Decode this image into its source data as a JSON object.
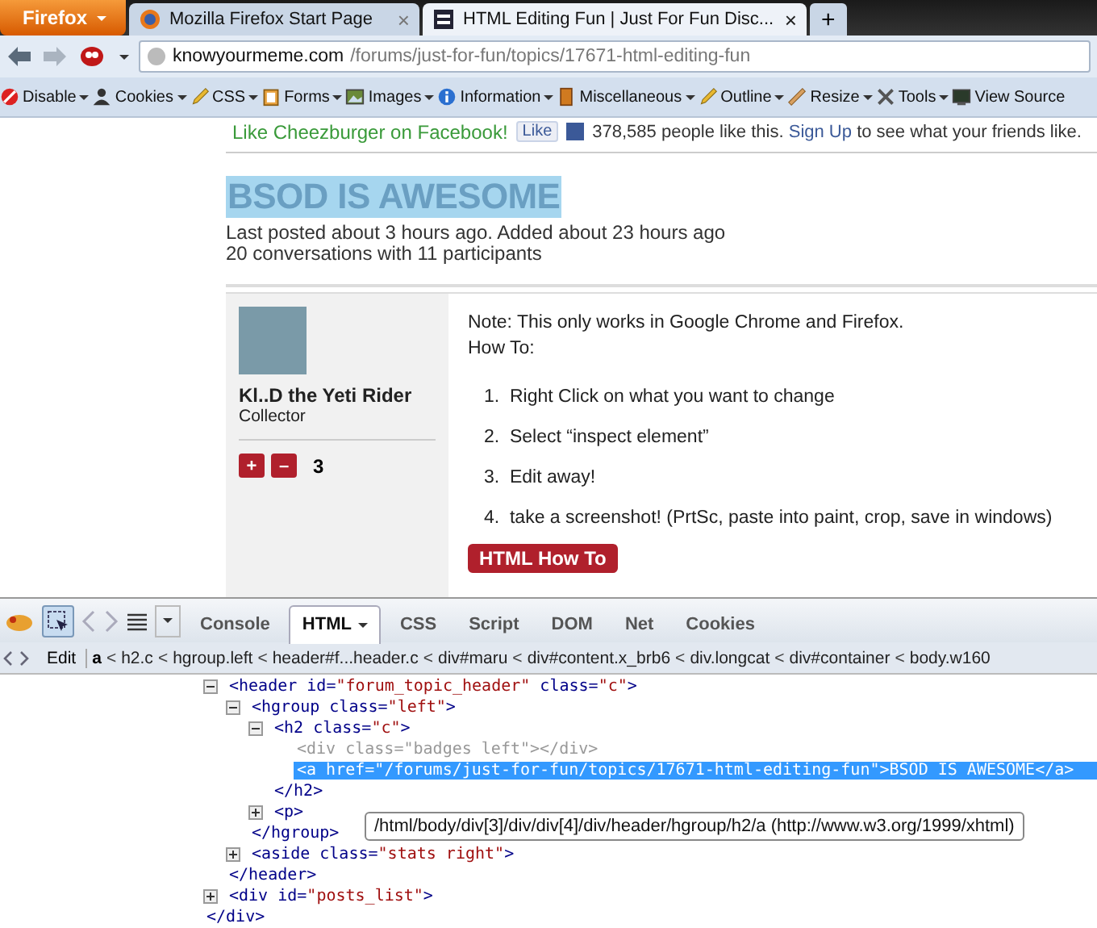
{
  "browser": {
    "menu_button": "Firefox",
    "tabs": [
      {
        "title": "Mozilla Firefox Start Page",
        "selected": false,
        "close": "×"
      },
      {
        "title": "HTML Editing Fun | Just For Fun Disc...",
        "selected": true,
        "close": "×"
      }
    ],
    "new_tab": "+",
    "url": {
      "domain": "knowyourmeme.com",
      "path": "/forums/just-for-fun/topics/17671-html-editing-fun"
    },
    "toolbar": [
      {
        "label": "Disable",
        "dropdown": true
      },
      {
        "label": "Cookies",
        "dropdown": true
      },
      {
        "label": "CSS",
        "dropdown": true
      },
      {
        "label": "Forms",
        "dropdown": true
      },
      {
        "label": "Images",
        "dropdown": true
      },
      {
        "label": "Information",
        "dropdown": true
      },
      {
        "label": "Miscellaneous",
        "dropdown": true
      },
      {
        "label": "Outline",
        "dropdown": true
      },
      {
        "label": "Resize",
        "dropdown": true
      },
      {
        "label": "Tools",
        "dropdown": true
      },
      {
        "label": "View Source",
        "dropdown": false
      }
    ]
  },
  "page": {
    "facebook": {
      "text": "Like Cheezburger on Facebook!",
      "like_button": "Like",
      "count": "378,585 people like this.",
      "signup_link": "Sign Up",
      "signup_rest": "to see what your friends like."
    },
    "topic": {
      "title": "BSOD IS AWESOME",
      "title_selected": true,
      "meta": [
        "Last posted about 3 hours ago. Added about 23 hours ago",
        "20 conversations with 11 participants"
      ]
    },
    "post": {
      "author": "Kl..D the Yeti Rider",
      "rank": "Collector",
      "vote_up": "+",
      "vote_down": "–",
      "score": "3",
      "lines": [
        "Note: This only works in Google Chrome and Firefox.",
        "How To:"
      ],
      "steps": [
        {
          "number": "1.",
          "text": "Right Click on what you want to change"
        },
        {
          "number": "2.",
          "text": "Select “inspect element”"
        },
        {
          "number": "3.",
          "text": "Edit away!"
        },
        {
          "number": "4.",
          "text": "take a screenshot! (PrtSc, paste into paint, crop, save in windows)"
        }
      ],
      "tag_button": "HTML How To"
    }
  },
  "devtools": {
    "inspect_on": true,
    "tabs": [
      {
        "label": "Console",
        "selected": false,
        "dropdown": false
      },
      {
        "label": "HTML",
        "selected": true,
        "dropdown": true
      },
      {
        "label": "CSS",
        "selected": false,
        "dropdown": false
      },
      {
        "label": "Script",
        "selected": false,
        "dropdown": false
      },
      {
        "label": "DOM",
        "selected": false,
        "dropdown": false
      },
      {
        "label": "Net",
        "selected": false,
        "dropdown": false
      },
      {
        "label": "Cookies",
        "selected": false,
        "dropdown": false
      }
    ],
    "edit_button": "Edit",
    "separator": "<",
    "breadcrumbs": [
      {
        "label": "a",
        "selected": true
      },
      {
        "label": "h2.c",
        "selected": false
      },
      {
        "label": "hgroup.left",
        "selected": false
      },
      {
        "label": "header#f...header.c",
        "selected": false
      },
      {
        "label": "div#maru",
        "selected": false
      },
      {
        "label": "div#content.x_brb6",
        "selected": false
      },
      {
        "label": "div.longcat",
        "selected": false
      },
      {
        "label": "div#container",
        "selected": false
      },
      {
        "label": "body.w160",
        "selected": false
      }
    ],
    "tree": [
      {
        "open": "<header id=\"forum_topic_header\" class=\"c\">",
        "expanded": true,
        "selected": false,
        "dimmed": false,
        "close": "</header>",
        "children": [
          {
            "open": "<hgroup class=\"left\">",
            "expanded": true,
            "selected": false,
            "dimmed": false,
            "close": "</hgroup>",
            "children": [
              {
                "open": "<h2 class=\"c\">",
                "expanded": true,
                "selected": false,
                "dimmed": false,
                "close": "</h2>",
                "children": [
                  {
                    "open": "<div class=\"badges left\"></div>",
                    "selected": false,
                    "dimmed": true
                  },
                  {
                    "open": "<a href=\"/forums/just-for-fun/topics/17671-html-editing-fun\">BSOD IS AWESOME</a>",
                    "selected": true,
                    "dimmed": false
                  }
                ]
              },
              {
                "open": "<p>",
                "expanded": false,
                "selected": false,
                "dimmed": false
              }
            ]
          },
          {
            "open": "<aside class=\"stats right\">",
            "expanded": false,
            "selected": false,
            "dimmed": false
          }
        ]
      },
      {
        "open": "<div id=\"posts_list\">",
        "expanded": false,
        "selected": false,
        "dimmed": false
      }
    ],
    "tree_end": "</div>",
    "tooltip": "/html/body/div[3]/div/div[4]/div/header/hgroup/h2/a (http://www.w3.org/1999/xhtml)"
  }
}
